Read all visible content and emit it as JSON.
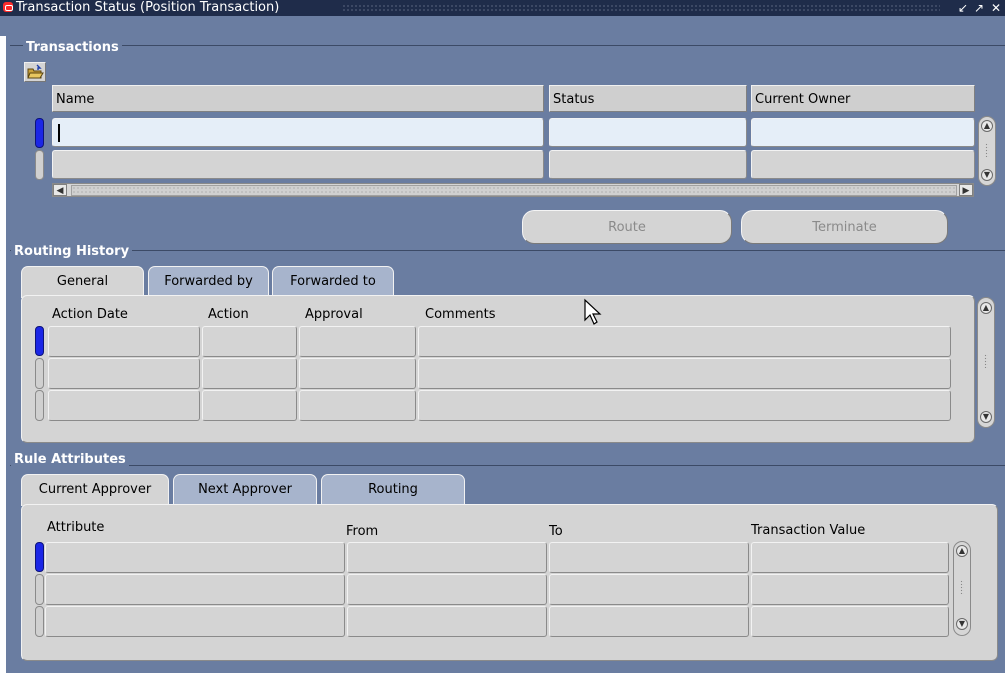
{
  "window": {
    "title": "Transaction Status (Position Transaction)",
    "controls": {
      "minimize": "↙",
      "maximize": "↗",
      "close": "✕"
    }
  },
  "transactions": {
    "section_title": "Transactions",
    "columns": [
      "Name",
      "Status",
      "Current Owner"
    ],
    "buttons": {
      "route": "Route",
      "terminate": "Terminate"
    }
  },
  "routing_history": {
    "section_title": "Routing History",
    "tabs": [
      "General",
      "Forwarded by",
      "Forwarded to"
    ],
    "active_tab": "General",
    "columns": [
      "Action Date",
      "Action",
      "Approval",
      "Comments"
    ]
  },
  "rule_attributes": {
    "section_title": "Rule Attributes",
    "tabs": [
      "Current Approver",
      "Next Approver",
      "Routing"
    ],
    "active_tab": "Current Approver",
    "columns": [
      "Attribute",
      "From",
      "To",
      "Transaction Value"
    ]
  },
  "colors": {
    "frame_background": "#6a7da1",
    "titlebar": "#1f2c4a",
    "record_indicator": "#1b26e6",
    "active_field": "#e5eef8"
  },
  "icons": [
    "oracle-logo-icon",
    "open-folder-icon",
    "mouse-pointer-icon",
    "scroll-up-icon",
    "scroll-down-icon",
    "scroll-left-icon",
    "scroll-right-icon"
  ]
}
